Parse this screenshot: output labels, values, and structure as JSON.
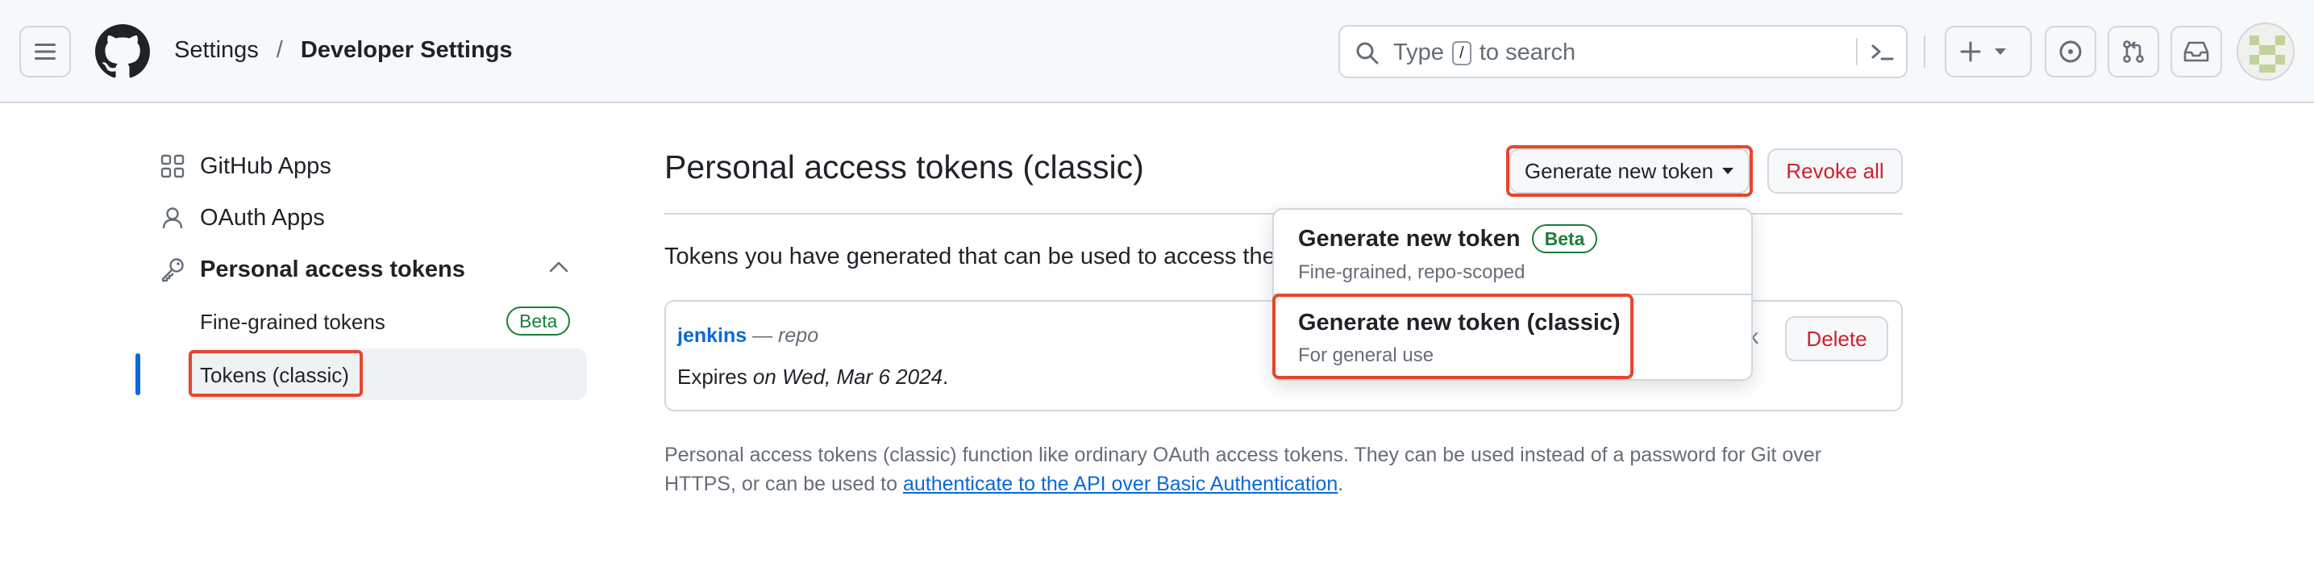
{
  "header": {
    "breadcrumb_parent": "Settings",
    "breadcrumb_separator": "/",
    "breadcrumb_current": "Developer Settings",
    "search_prefix": "Type",
    "search_key": "/",
    "search_suffix": "to search",
    "icons": [
      "menu-icon",
      "github-logo-icon",
      "search-icon",
      "command-palette-icon",
      "plus-icon",
      "chevron-down-icon",
      "issue-icon",
      "pull-request-icon",
      "inbox-icon"
    ]
  },
  "sidebar": {
    "items": [
      {
        "label": "GitHub Apps",
        "icon": "apps-icon"
      },
      {
        "label": "OAuth Apps",
        "icon": "person-icon"
      },
      {
        "label": "Personal access tokens",
        "icon": "key-icon"
      }
    ],
    "subitems": [
      {
        "label": "Fine-grained tokens",
        "badge": "Beta"
      },
      {
        "label": "Tokens (classic)"
      }
    ]
  },
  "main": {
    "title": "Personal access tokens (classic)",
    "generate_button": "Generate new token",
    "revoke_button": "Revoke all",
    "description": "Tokens you have generated that can be used to access the",
    "token": {
      "name": "jenkins",
      "scope_separator": " — ",
      "scope": "repo",
      "expires_prefix": "Expires ",
      "expires_date": "on Wed, Mar 6 2024",
      "expires_suffix": ".",
      "partial_text": "k",
      "delete_button": "Delete"
    },
    "footer_text": "Personal access tokens (classic) function like ordinary OAuth access tokens. They can be used instead of a password for Git over HTTPS, or can be used to ",
    "footer_link": "authenticate to the API over Basic Authentication",
    "footer_end": "."
  },
  "dropdown": {
    "items": [
      {
        "title": "Generate new token",
        "badge": "Beta",
        "subtitle": "Fine-grained, repo-scoped"
      },
      {
        "title": "Generate new token (classic)",
        "subtitle": "For general use"
      }
    ]
  },
  "colors": {
    "accent": "#0969da",
    "danger": "#cf222e",
    "success": "#1a7f37",
    "highlight": "#e8452c"
  }
}
